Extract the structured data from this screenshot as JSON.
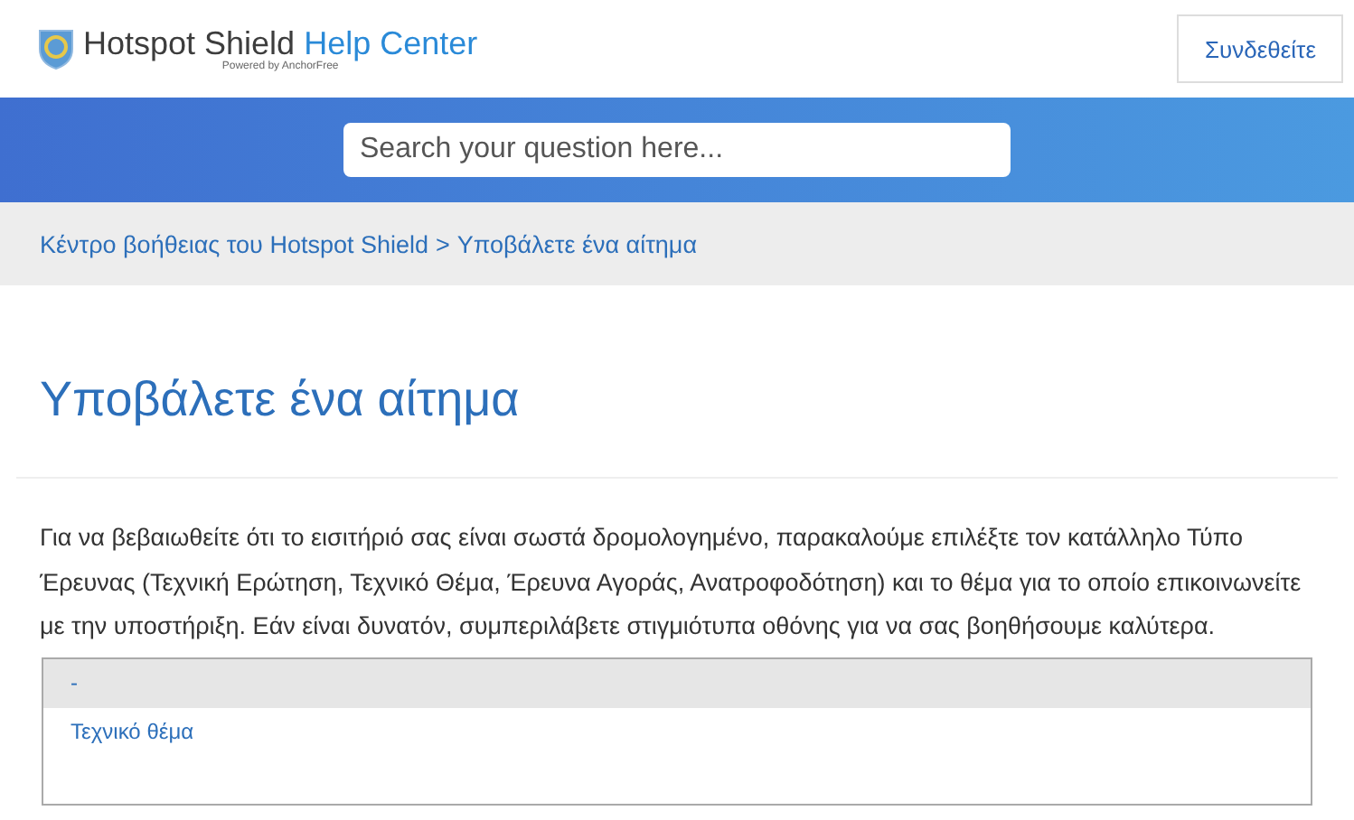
{
  "header": {
    "logo": {
      "brand": "Hotspot Shield",
      "product": "Help Center",
      "tagline": "Powered by AnchorFree"
    },
    "sign_in": "Συνδεθείτε"
  },
  "search": {
    "placeholder": "Search your question here..."
  },
  "breadcrumb": [
    {
      "label": "Κέντρο βοήθειας του Hotspot Shield"
    },
    {
      "label": "Υποβάλετε ένα αίτημα"
    }
  ],
  "breadcrumb_separator": ">",
  "title": "Υποβάλετε ένα αίτημα",
  "intro": "Για να βεβαιωθείτε ότι το εισιτήριό σας είναι σωστά δρομολογημένο, παρακαλούμε επιλέξτε τον κατάλληλο Τύπο Έρευνας (Τεχνική Ερώτηση, Τεχνικό Θέμα, Έρευνα Αγοράς, Ανατροφοδότηση) και το θέμα για το οποίο επικοινωνείτε με την υποστήριξη. Εάν είναι δυνατόν, συμπεριλάβετε στιγμιότυπα οθόνης για να σας βοηθήσουμε καλύτερα.",
  "options": [
    {
      "label": "-",
      "selected": true
    },
    {
      "label": "Τεχνικό θέμα",
      "selected": false
    }
  ]
}
